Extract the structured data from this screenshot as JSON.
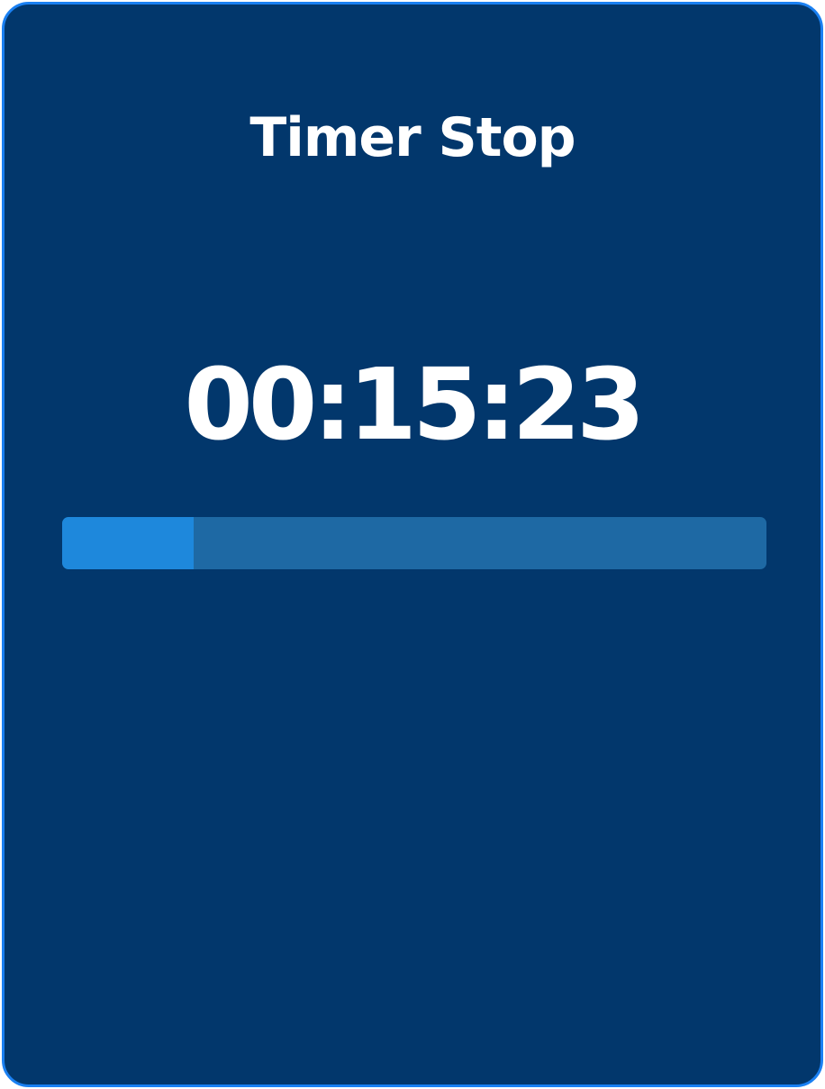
{
  "timer": {
    "title": "Timer Stop",
    "elapsed": "00:15:23",
    "progress_fraction": 0.187
  },
  "colors": {
    "card_background": "#02376c",
    "card_border": "#1a80f2",
    "text": "#ffffff",
    "progress_track": "#1e69a4",
    "progress_fill": "#1e88dc"
  }
}
